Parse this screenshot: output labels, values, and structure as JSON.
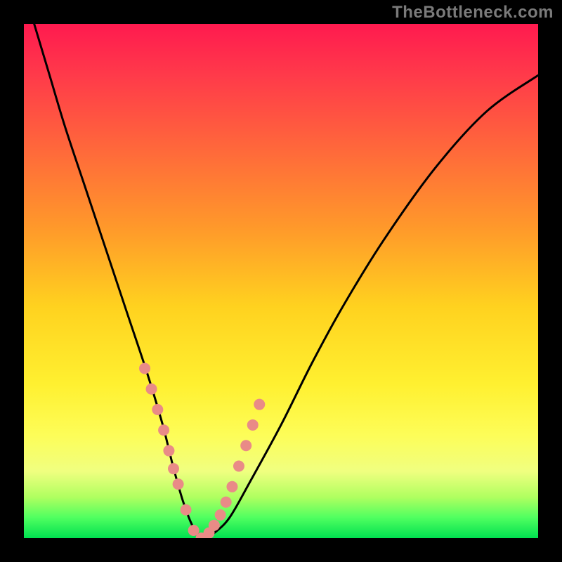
{
  "watermark": "TheBottleneck.com",
  "chart_data": {
    "type": "line",
    "title": "",
    "xlabel": "",
    "ylabel": "",
    "xlim": [
      0,
      100
    ],
    "ylim": [
      0,
      100
    ],
    "background_gradient": {
      "top_color": "#ff1a4f",
      "bottom_color": "#00e050",
      "description": "vertical gradient red→orange→yellow→green"
    },
    "series": [
      {
        "name": "bottleneck-curve",
        "color": "#000000",
        "stroke_width": 3,
        "x": [
          2,
          5,
          8,
          12,
          16,
          20,
          24,
          27,
          29,
          31,
          33,
          35,
          37,
          40,
          44,
          50,
          56,
          62,
          70,
          80,
          90,
          100
        ],
        "y": [
          100,
          90,
          80,
          68,
          56,
          44,
          32,
          22,
          14,
          7,
          2,
          0,
          1,
          4,
          11,
          22,
          34,
          45,
          58,
          72,
          83,
          90
        ]
      },
      {
        "name": "highlight-dots",
        "color": "#e98b87",
        "marker_radius": 8,
        "x": [
          23.5,
          24.8,
          26.0,
          27.2,
          28.2,
          29.1,
          30.0,
          31.5,
          33.0,
          34.5,
          36.0,
          37.0,
          38.2,
          39.3,
          40.5,
          41.8,
          43.2,
          44.5,
          45.8
        ],
        "y": [
          33.0,
          29.0,
          25.0,
          21.0,
          17.0,
          13.5,
          10.5,
          5.5,
          1.5,
          0.0,
          1.0,
          2.5,
          4.5,
          7.0,
          10.0,
          14.0,
          18.0,
          22.0,
          26.0
        ]
      }
    ]
  }
}
